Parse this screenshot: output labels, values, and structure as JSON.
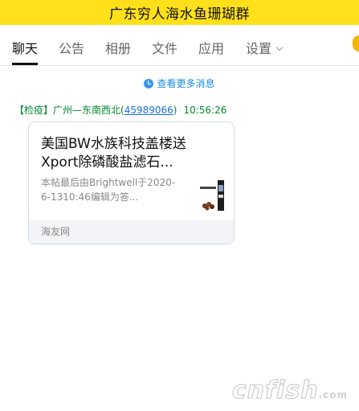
{
  "header": {
    "title": "广东穷人海水鱼珊瑚群"
  },
  "tabs": [
    {
      "label": "聊天"
    },
    {
      "label": "公告"
    },
    {
      "label": "相册"
    },
    {
      "label": "文件"
    },
    {
      "label": "应用"
    },
    {
      "label": "设置"
    }
  ],
  "history_link": "查看更多消息",
  "message": {
    "tag": "【检疫】",
    "sender_name": "广州—东南西北",
    "qq_open": "(",
    "qq": "45989066",
    "qq_close": ")",
    "time": "10:56:26",
    "card": {
      "title": "美国BW水族科技盖楼送Xport除磷酸盐滤石...",
      "description": "本帖最后由Brightwell于2020-6-1310:46编辑为答...",
      "source": "海友网"
    }
  },
  "watermark": {
    "text": "cnfish",
    "suffix": ".com"
  },
  "colors": {
    "header_bg": "#ffe01a",
    "link": "#1a8ce3",
    "sender": "#008a2e"
  }
}
